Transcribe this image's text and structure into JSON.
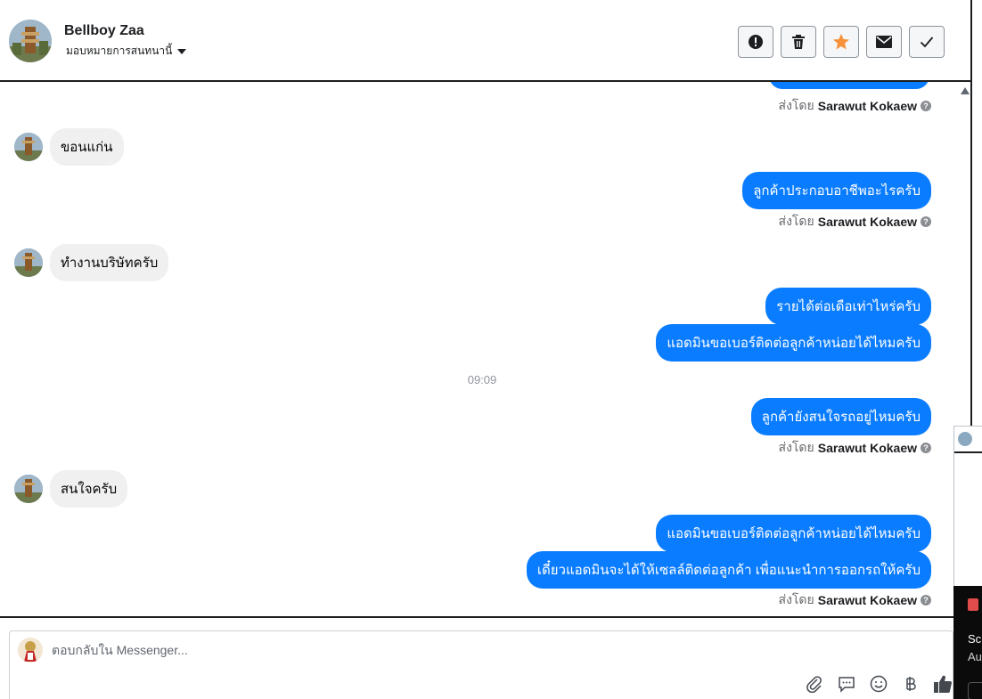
{
  "header": {
    "name": "Bellboy Zaa",
    "assign_label": "มอบหมายการสนทนานี้",
    "actions": [
      {
        "icon": "alert-icon",
        "label": "!"
      },
      {
        "icon": "trash-icon",
        "label": ""
      },
      {
        "icon": "star-icon",
        "label": ""
      },
      {
        "icon": "mail-icon",
        "label": ""
      },
      {
        "icon": "check-icon",
        "label": ""
      }
    ]
  },
  "colors": {
    "outgoing_bubble": "#0a7cff",
    "incoming_bubble": "#f0f0f0",
    "star": "#f7923b"
  },
  "sent_by_prefix": "ส่งโดย",
  "sender_name": "Sarawut Kokaew",
  "messages": {
    "in_1": "ขอนแก่น",
    "out_1": "ลูกค้าประกอบอาชีพอะไรครับ",
    "in_2": "ทำงานบริษัทครับ",
    "out_2": "รายได้ต่อเดือเท่าไหร่ครับ",
    "out_3": "แอดมินขอเบอร์ติดต่อลูกค้าหน่อยได้ไหมครับ",
    "time_1": "09:09",
    "out_4": "ลูกค้ายังสนใจรถอยู่ไหมครับ",
    "in_3": "สนใจครับ",
    "out_5": "แอดมินขอเบอร์ติดต่อลูกค้าหน่อยได้ไหมครับ",
    "out_6": "เดี๋ยวแอดมินจะได้ให้เซลล์ติดต่อลูกค้า เพื่อแนะนำการออกรถให้ครับ"
  },
  "composer": {
    "placeholder": "ตอบกลับใน Messenger...",
    "tools": [
      "paperclip-icon",
      "comment-icon",
      "emoji-icon",
      "baht-icon",
      "thumbs-up-icon"
    ]
  },
  "overlay": {
    "title": "Sc",
    "subtitle": "Au"
  }
}
